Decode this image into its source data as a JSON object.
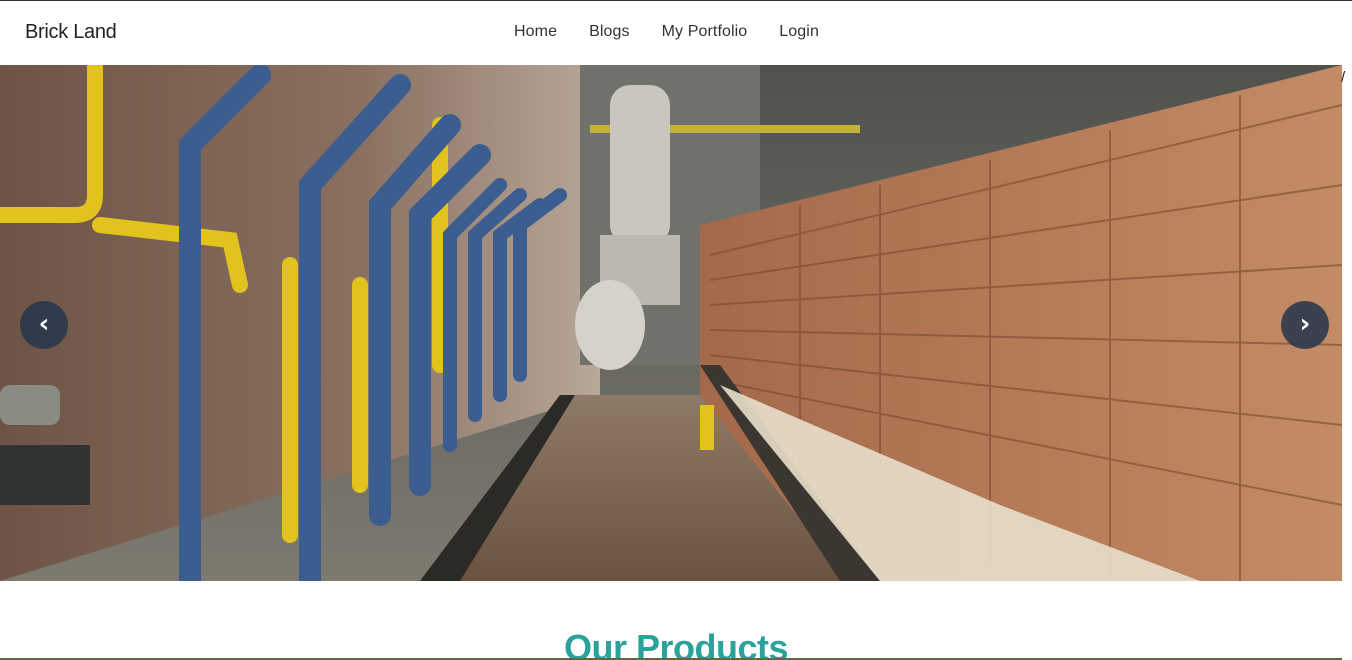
{
  "brand": {
    "name": "Brick Land"
  },
  "nav": {
    "items": [
      {
        "label": "Home"
      },
      {
        "label": "Blogs"
      },
      {
        "label": "My Portfolio"
      },
      {
        "label": "Login"
      }
    ]
  },
  "edge_mark": "/",
  "carousel": {
    "prev_icon": "‹",
    "next_icon": "›",
    "image_subject": "brick-factory-kiln-icon"
  },
  "section": {
    "title": "Our Products"
  },
  "colors": {
    "accent": "#2aa39a",
    "control_bg": "#28374b"
  }
}
